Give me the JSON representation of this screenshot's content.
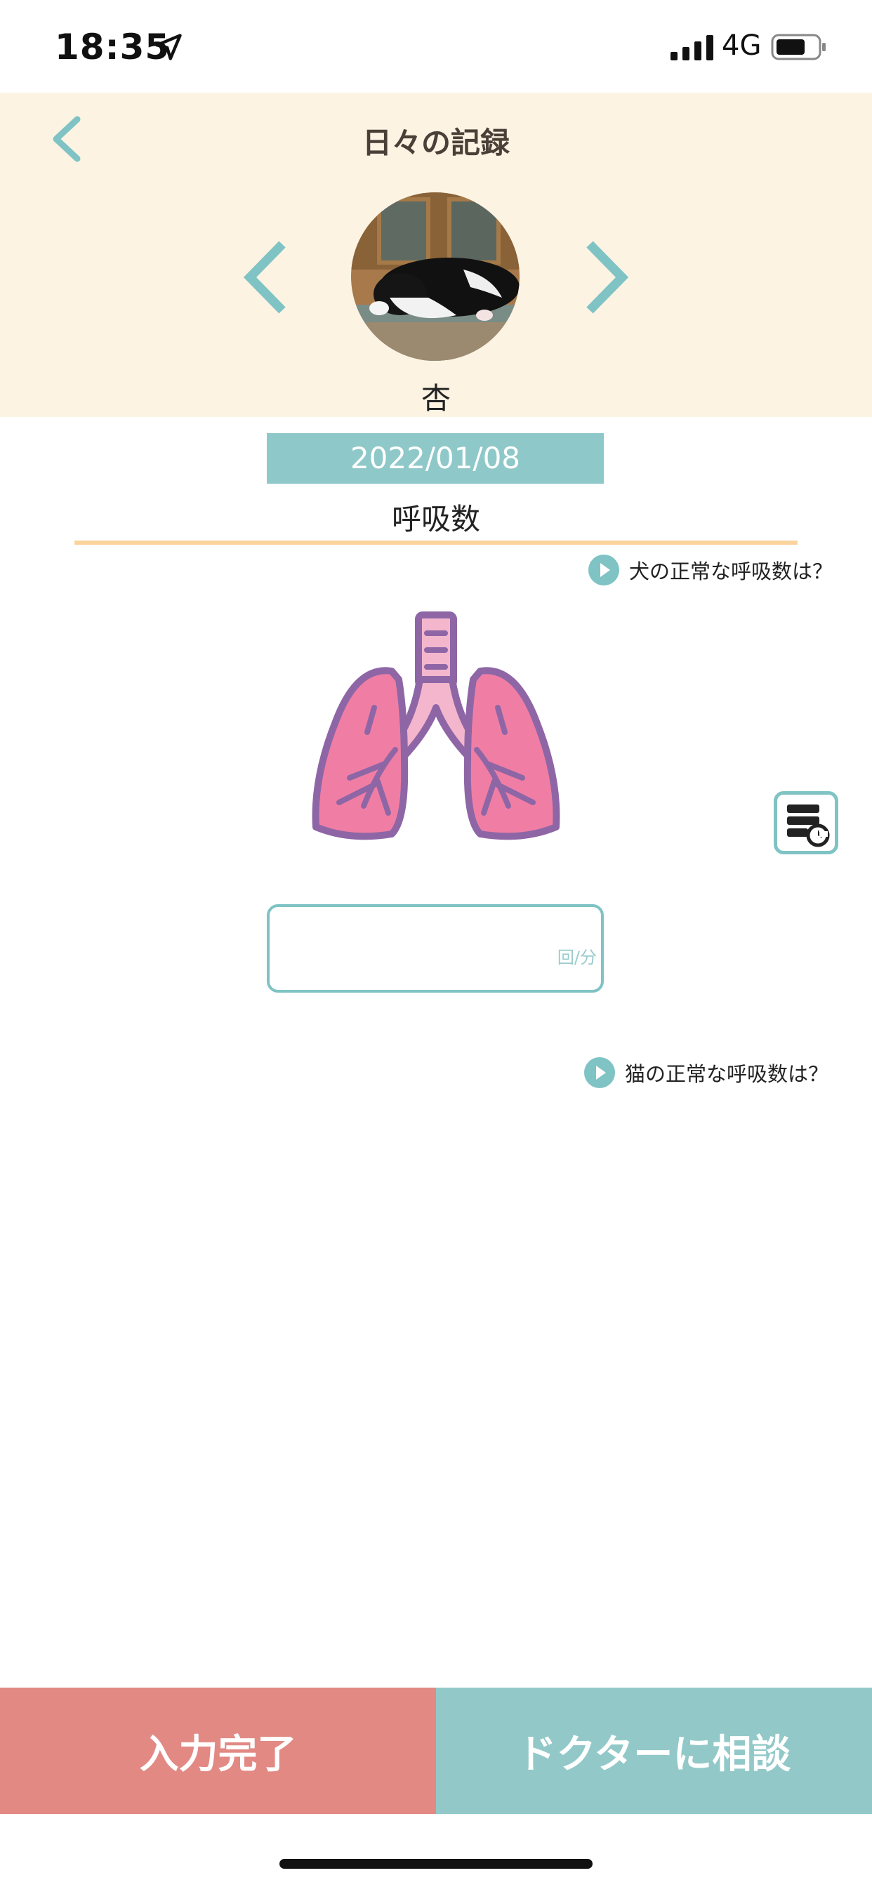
{
  "status_bar": {
    "time": "18:35",
    "network": "4G",
    "icons": [
      "location-arrow-icon",
      "signal-icon",
      "battery-icon"
    ]
  },
  "header": {
    "title": "日々の記録",
    "pet_name": "杏",
    "icons": [
      "chevron-left-icon",
      "chevron-left-icon",
      "chevron-right-icon"
    ]
  },
  "record": {
    "date": "2022/01/08",
    "section_title": "呼吸数",
    "help_dog": "犬の正常な呼吸数は？",
    "help_cat": "猫の正常な呼吸数は？",
    "input_value": "",
    "unit": "回/分",
    "illustration": "lungs-icon",
    "history_icon": "history-list-icon"
  },
  "actions": {
    "done_label": "入力完了",
    "doctor_label": "ドクターに相談"
  },
  "colors": {
    "header_bg": "#fcf3e3",
    "teal": "#7fc3c4",
    "date_bg": "#8fc8c8",
    "done_bg": "#e28984",
    "doctor_bg": "#92c9c8",
    "underline": "#fbd49d",
    "lung_pink": "#f07ea4",
    "lung_stroke": "#8e66a6"
  }
}
